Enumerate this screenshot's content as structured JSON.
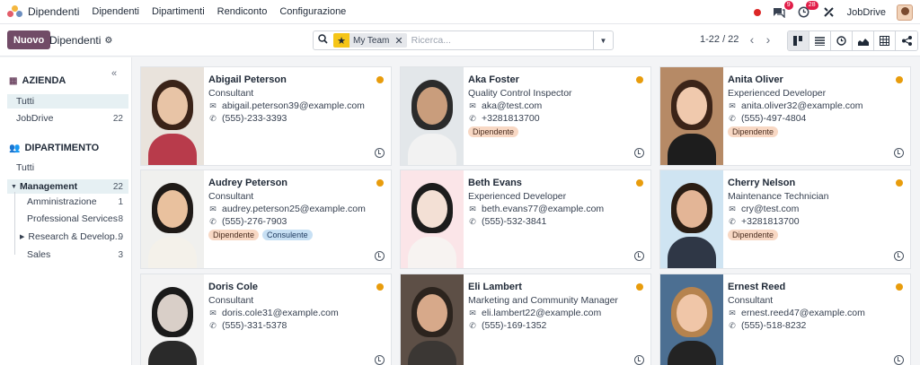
{
  "app": {
    "name": "Dipendenti"
  },
  "menu": [
    "Dipendenti",
    "Dipartimenti",
    "Rendiconto",
    "Configurazione"
  ],
  "systray": {
    "messages_badge": "9",
    "activities_badge": "28",
    "company": "JobDrive"
  },
  "control": {
    "new_label": "Nuovo",
    "view_title": "Dipendenti",
    "facet": "My Team",
    "search_placeholder": "Ricerca...",
    "pager": "1-22 / 22"
  },
  "sidebar": {
    "azienda_title": "AZIENDA",
    "azienda_items": [
      {
        "label": "Tutti",
        "count": ""
      },
      {
        "label": "JobDrive",
        "count": "22"
      }
    ],
    "dipartimento_title": "DIPARTIMENTO",
    "dep_all": "Tutti",
    "dep_items": [
      {
        "label": "Management",
        "count": "22"
      },
      {
        "label": "Amministrazione",
        "count": "1"
      },
      {
        "label": "Professional Services",
        "count": "8"
      },
      {
        "label": "Research & Develop...",
        "count": "9"
      },
      {
        "label": "Sales",
        "count": "3"
      }
    ]
  },
  "employees": [
    {
      "name": "Abigail Peterson",
      "job": "Consultant",
      "email": "abigail.peterson39@example.com",
      "phone": "(555)-233-3393",
      "tags": []
    },
    {
      "name": "Aka Foster",
      "job": "Quality Control Inspector",
      "email": "aka@test.com",
      "phone": "+3281813700",
      "tags": [
        "Dipendente"
      ]
    },
    {
      "name": "Anita Oliver",
      "job": "Experienced Developer",
      "email": "anita.oliver32@example.com",
      "phone": "(555)-497-4804",
      "tags": [
        "Dipendente"
      ]
    },
    {
      "name": "Audrey Peterson",
      "job": "Consultant",
      "email": "audrey.peterson25@example.com",
      "phone": "(555)-276-7903",
      "tags": [
        "Dipendente",
        "Consulente"
      ]
    },
    {
      "name": "Beth Evans",
      "job": "Experienced Developer",
      "email": "beth.evans77@example.com",
      "phone": "(555)-532-3841",
      "tags": []
    },
    {
      "name": "Cherry Nelson",
      "job": "Maintenance Technician",
      "email": "cry@test.com",
      "phone": "+3281813700",
      "tags": [
        "Dipendente"
      ]
    },
    {
      "name": "Doris Cole",
      "job": "Consultant",
      "email": "doris.cole31@example.com",
      "phone": "(555)-331-5378",
      "tags": []
    },
    {
      "name": "Eli Lambert",
      "job": "Marketing and Community Manager",
      "email": "eli.lambert22@example.com",
      "phone": "(555)-169-1352",
      "tags": []
    },
    {
      "name": "Ernest Reed",
      "job": "Consultant",
      "email": "ernest.reed47@example.com",
      "phone": "(555)-518-8232",
      "tags": []
    }
  ],
  "colors": {
    "brand": "#714b67",
    "status_dot": "#e89c0c",
    "tag_dipendente": "#f8d8c4",
    "tag_consulente": "#c7e0f4"
  },
  "icons": {
    "search": "search-icon",
    "favorite": "star-icon",
    "kanban": "kanban-icon",
    "list": "list-icon",
    "activity": "clock-icon",
    "graph": "graph-icon",
    "pivot": "pivot-icon",
    "hierarchy": "hierarchy-icon"
  }
}
